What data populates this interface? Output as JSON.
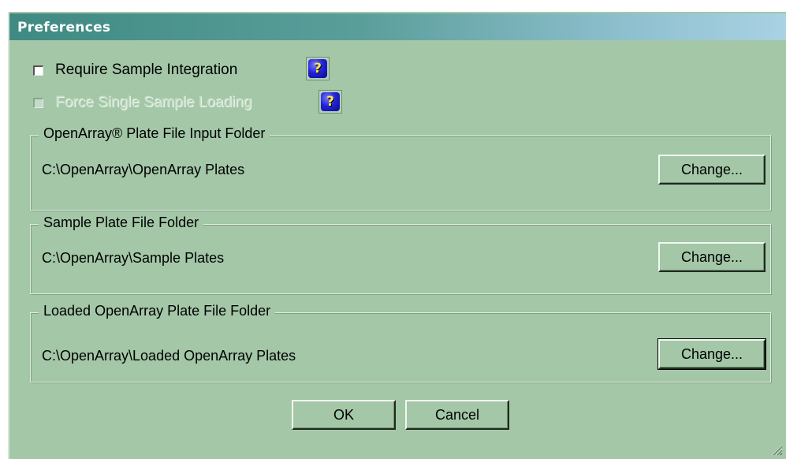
{
  "window": {
    "title": "Preferences"
  },
  "options": {
    "require_sample_integration": {
      "label": "Require Sample Integration",
      "checked": false,
      "enabled": true
    },
    "force_single_sample_loading": {
      "label": "Force Single Sample Loading",
      "checked": false,
      "enabled": false
    },
    "help_glyph": "?"
  },
  "folders": {
    "openarray_input": {
      "legend": "OpenArray® Plate File Input Folder",
      "path": "C:\\OpenArray\\OpenArray Plates",
      "button_label": "Change..."
    },
    "sample_plate": {
      "legend": "Sample Plate File Folder",
      "path": "C:\\OpenArray\\Sample Plates",
      "button_label": "Change..."
    },
    "loaded_openarray": {
      "legend": "Loaded OpenArray Plate File Folder",
      "path": "C:\\OpenArray\\Loaded OpenArray Plates",
      "button_label": "Change..."
    }
  },
  "footer": {
    "ok_label": "OK",
    "cancel_label": "Cancel"
  },
  "colors": {
    "background": "#a3c7a7",
    "title_gradient_start": "#3f8a82",
    "title_gradient_end": "#a9d2e3",
    "help_icon_blue": "#2222d6",
    "help_icon_glyph": "#ffe94a"
  }
}
